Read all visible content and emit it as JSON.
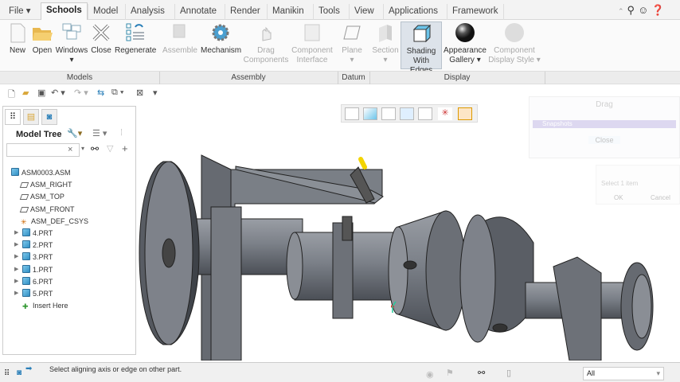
{
  "menu": {
    "file": "File",
    "tabs": [
      "Schools",
      "Model",
      "Analysis",
      "Annotate",
      "Render",
      "Manikin",
      "Tools",
      "View",
      "Applications",
      "Framework"
    ],
    "active_tab": "Schools"
  },
  "ribbon": {
    "buttons": [
      {
        "label": "New",
        "icon": "new-file-icon"
      },
      {
        "label": "Open",
        "icon": "open-folder-icon"
      },
      {
        "label": "Windows",
        "icon": "windows-icon"
      },
      {
        "label": "Close",
        "icon": "close-x-icon"
      },
      {
        "label": "Regenerate",
        "icon": "regenerate-icon"
      },
      {
        "label": "Assemble",
        "icon": "assemble-icon",
        "disabled": true
      },
      {
        "label": "Mechanism",
        "icon": "gear-icon"
      },
      {
        "label": "Drag Components",
        "icon": "drag-hand-icon",
        "disabled": true
      },
      {
        "label": "Component Interface",
        "icon": "component-interface-icon",
        "disabled": true
      },
      {
        "label": "Plane",
        "icon": "plane-icon",
        "disabled": true
      },
      {
        "label": "Section",
        "icon": "section-icon",
        "disabled": true
      },
      {
        "label": "Shading With Edges",
        "icon": "shading-cube-icon",
        "selected": true
      },
      {
        "label": "Appearance Gallery",
        "icon": "sphere-icon"
      },
      {
        "label": "Component Display Style",
        "icon": "faded-sphere-icon",
        "disabled": true
      }
    ],
    "groups": [
      "Models",
      "Assembly",
      "Datum",
      "Display"
    ]
  },
  "model_tree": {
    "title": "Model Tree",
    "search_value": "",
    "items": [
      {
        "label": "ASM0003.ASM",
        "type": "assembly"
      },
      {
        "label": "ASM_RIGHT",
        "type": "plane"
      },
      {
        "label": "ASM_TOP",
        "type": "plane"
      },
      {
        "label": "ASM_FRONT",
        "type": "plane"
      },
      {
        "label": "ASM_DEF_CSYS",
        "type": "csys"
      },
      {
        "label": "4.PRT",
        "type": "part"
      },
      {
        "label": "2.PRT",
        "type": "part"
      },
      {
        "label": "3.PRT",
        "type": "part"
      },
      {
        "label": "1.PRT",
        "type": "part"
      },
      {
        "label": "6.PRT",
        "type": "part"
      },
      {
        "label": "5.PRT",
        "type": "part"
      },
      {
        "label": "Insert Here",
        "type": "insert"
      }
    ]
  },
  "drag_dialog": {
    "title": "Drag",
    "row": "Snapshots",
    "close": "Close"
  },
  "select_dialog": {
    "text": "Select 1 item",
    "ok": "OK",
    "cancel": "Cancel"
  },
  "status": {
    "message": "Select aligning axis or edge on other part.",
    "filter": "All"
  },
  "colors": {
    "accent": "#2f8fc4",
    "part": "#6b7078",
    "background": "#ffffff"
  }
}
